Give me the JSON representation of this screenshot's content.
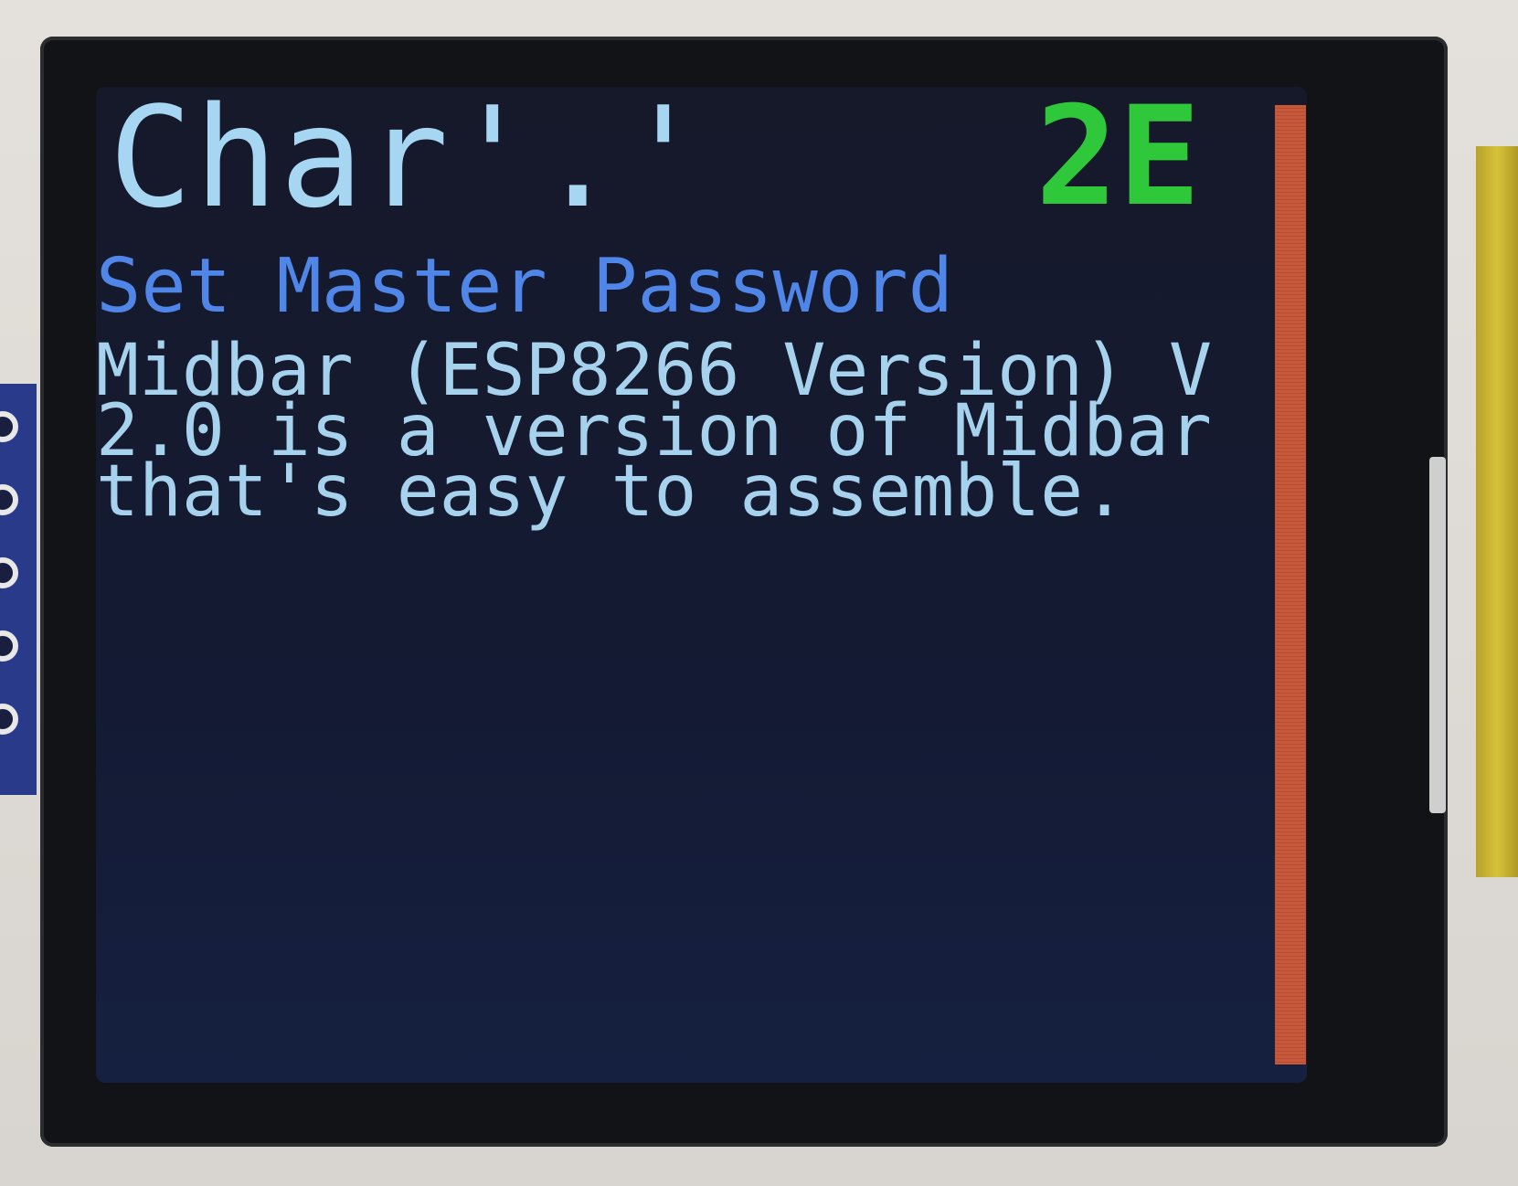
{
  "screen": {
    "char_label": "Char'.'",
    "char_code": "2E",
    "subtitle": "Set Master Password",
    "message": "Midbar (ESP8266 Version) V 2.0 is a version of Midbar  that's easy to assemble."
  },
  "colors": {
    "background": "#141a33",
    "char_label": "#a7d6f2",
    "char_code": "#2fc83a",
    "subtitle": "#4f86e8",
    "message": "#a6d2ee",
    "scrollbar": "#c8583a"
  }
}
